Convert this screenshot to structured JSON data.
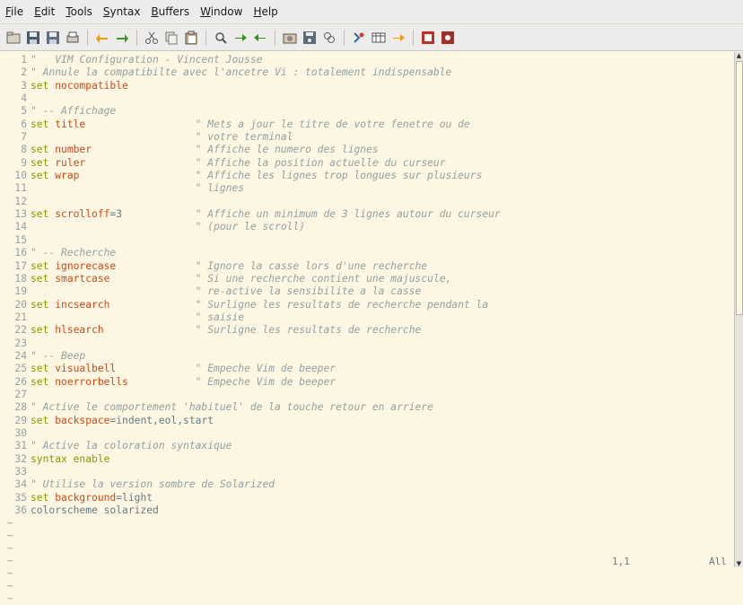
{
  "menubar": {
    "items": [
      {
        "mn": "F",
        "rest": "ile"
      },
      {
        "mn": "E",
        "rest": "dit"
      },
      {
        "mn": "T",
        "rest": "ools"
      },
      {
        "mn": "S",
        "rest": "yntax"
      },
      {
        "mn": "B",
        "rest": "uffers"
      },
      {
        "mn": "W",
        "rest": "indow"
      },
      {
        "mn": "H",
        "rest": "elp"
      }
    ]
  },
  "toolbar": {
    "buttons": [
      "open-icon",
      "save-icon",
      "save-all-icon",
      "print-icon",
      "undo-icon",
      "redo-icon",
      "cut-icon",
      "copy-icon",
      "paste-icon",
      "replace-icon",
      "find-next-icon",
      "find-prev-icon",
      "load-session-icon",
      "save-session-icon",
      "run-script-icon",
      "make-icon",
      "shell-icon",
      "tag-jump-icon",
      "help-icon",
      "find-help-icon"
    ],
    "colors": {
      "undo": "#e0a010",
      "redo": "#3a9a24",
      "find": "#2f8f1f",
      "red": "#c0302a"
    }
  },
  "editor": {
    "lines": [
      [
        [
          "cm",
          "\" "
        ],
        [
          "cursor",
          "█"
        ],
        [
          "cm",
          " VIM Configuration - Vincent Jousse"
        ]
      ],
      [
        [
          "cm",
          "\" Annule la compatibilte avec l'ancetre Vi : totalement indispensable"
        ]
      ],
      [
        [
          "kw",
          "set"
        ],
        [
          "tx",
          " "
        ],
        [
          "op",
          "nocompatible"
        ]
      ],
      [],
      [
        [
          "cm",
          "\" -- Affichage"
        ]
      ],
      [
        [
          "kw",
          "set"
        ],
        [
          "tx",
          " "
        ],
        [
          "op",
          "title"
        ],
        [
          "tx",
          "                  "
        ],
        [
          "cm",
          "\" Mets a jour le titre de votre fenetre ou de"
        ]
      ],
      [
        [
          "tx",
          "                           "
        ],
        [
          "cm",
          "\" votre terminal"
        ]
      ],
      [
        [
          "kw",
          "set"
        ],
        [
          "tx",
          " "
        ],
        [
          "op",
          "number"
        ],
        [
          "tx",
          "                 "
        ],
        [
          "cm",
          "\" Affiche le numero des lignes"
        ]
      ],
      [
        [
          "kw",
          "set"
        ],
        [
          "tx",
          " "
        ],
        [
          "op",
          "ruler"
        ],
        [
          "tx",
          "                  "
        ],
        [
          "cm",
          "\" Affiche la position actuelle du curseur"
        ]
      ],
      [
        [
          "kw",
          "set"
        ],
        [
          "tx",
          " "
        ],
        [
          "op",
          "wrap"
        ],
        [
          "tx",
          "                   "
        ],
        [
          "cm",
          "\" Affiche les lignes trop longues sur plusieurs"
        ]
      ],
      [
        [
          "tx",
          "                           "
        ],
        [
          "cm",
          "\" lignes"
        ]
      ],
      [],
      [
        [
          "kw",
          "set"
        ],
        [
          "tx",
          " "
        ],
        [
          "op",
          "scrolloff"
        ],
        [
          "tx",
          "=3"
        ],
        [
          "tx",
          "            "
        ],
        [
          "cm",
          "\" Affiche un minimum de 3 lignes autour du curseur"
        ]
      ],
      [
        [
          "tx",
          "                           "
        ],
        [
          "cm",
          "\" (pour le scroll)"
        ]
      ],
      [],
      [
        [
          "cm",
          "\" -- Recherche"
        ]
      ],
      [
        [
          "kw",
          "set"
        ],
        [
          "tx",
          " "
        ],
        [
          "op",
          "ignorecase"
        ],
        [
          "tx",
          "             "
        ],
        [
          "cm",
          "\" Ignore la casse lors d'une recherche"
        ]
      ],
      [
        [
          "kw",
          "set"
        ],
        [
          "tx",
          " "
        ],
        [
          "op",
          "smartcase"
        ],
        [
          "tx",
          "              "
        ],
        [
          "cm",
          "\" Si une recherche contient une majuscule,"
        ]
      ],
      [
        [
          "tx",
          "                           "
        ],
        [
          "cm",
          "\" re-active la sensibilite a la casse"
        ]
      ],
      [
        [
          "kw",
          "set"
        ],
        [
          "tx",
          " "
        ],
        [
          "op",
          "incsearch"
        ],
        [
          "tx",
          "              "
        ],
        [
          "cm",
          "\" Surligne les resultats de recherche pendant la"
        ]
      ],
      [
        [
          "tx",
          "                           "
        ],
        [
          "cm",
          "\" saisie"
        ]
      ],
      [
        [
          "kw",
          "set"
        ],
        [
          "tx",
          " "
        ],
        [
          "op",
          "hlsearch"
        ],
        [
          "tx",
          "               "
        ],
        [
          "cm",
          "\" Surligne les resultats de recherche"
        ]
      ],
      [],
      [
        [
          "cm",
          "\" -- Beep"
        ]
      ],
      [
        [
          "kw",
          "set"
        ],
        [
          "tx",
          " "
        ],
        [
          "op",
          "visualbell"
        ],
        [
          "tx",
          "             "
        ],
        [
          "cm",
          "\" Empeche Vim de beeper"
        ]
      ],
      [
        [
          "kw",
          "set"
        ],
        [
          "tx",
          " "
        ],
        [
          "op",
          "noerrorbells"
        ],
        [
          "tx",
          "           "
        ],
        [
          "cm",
          "\" Empeche Vim de beeper"
        ]
      ],
      [],
      [
        [
          "cm",
          "\" Active le comportement 'habituel' de la touche retour en arriere"
        ]
      ],
      [
        [
          "kw",
          "set"
        ],
        [
          "tx",
          " "
        ],
        [
          "op",
          "backspace"
        ],
        [
          "tx",
          "=indent,eol,start"
        ]
      ],
      [],
      [
        [
          "cm",
          "\" Active la coloration syntaxique"
        ]
      ],
      [
        [
          "kw",
          "syntax"
        ],
        [
          "tx",
          " "
        ],
        [
          "kw",
          "enable"
        ]
      ],
      [],
      [
        [
          "cm",
          "\" Utilise la version sombre de Solarized"
        ]
      ],
      [
        [
          "kw",
          "set"
        ],
        [
          "tx",
          " "
        ],
        [
          "op",
          "background"
        ],
        [
          "tx",
          "=light"
        ]
      ],
      [
        [
          "tx",
          "colorscheme solarized"
        ]
      ]
    ],
    "tilde": "~",
    "tilde_count": 7
  },
  "status": {
    "position": "1,1",
    "scroll": "All"
  },
  "scrollbar": {
    "visible_fraction": 0.51
  }
}
